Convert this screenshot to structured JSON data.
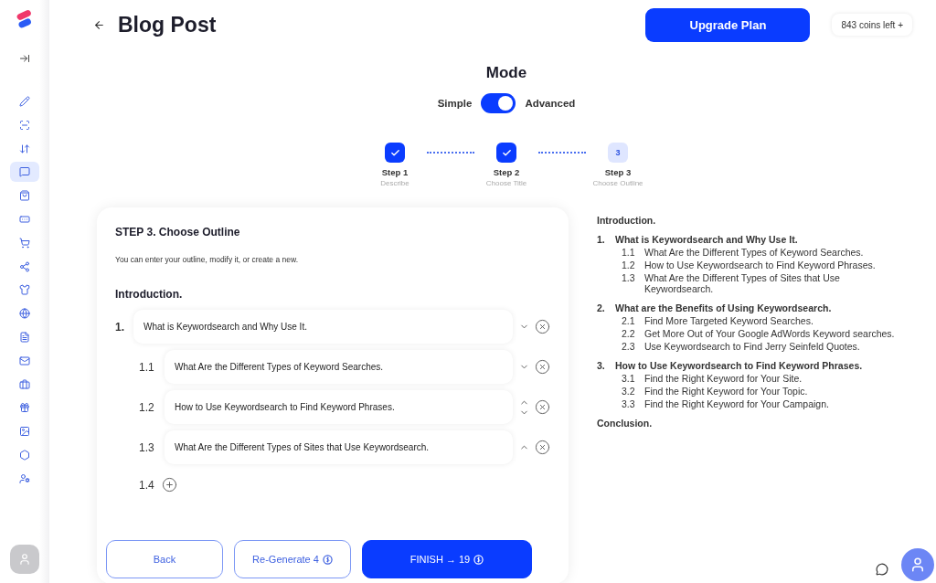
{
  "sidebar": {
    "items": [
      {
        "selected": false
      },
      {
        "selected": false
      },
      {
        "selected": false
      },
      {
        "selected": true
      },
      {
        "selected": false
      },
      {
        "selected": false
      },
      {
        "selected": false
      },
      {
        "selected": false
      },
      {
        "selected": false
      },
      {
        "selected": false
      },
      {
        "selected": false
      },
      {
        "selected": false
      },
      {
        "selected": false
      },
      {
        "selected": false
      },
      {
        "selected": false
      },
      {
        "selected": false
      },
      {
        "selected": false
      }
    ]
  },
  "header": {
    "title": "Blog Post",
    "upgrade_button": "Upgrade Plan",
    "coins": "843 coins left",
    "coins_add": "+"
  },
  "mode": {
    "title": "Mode",
    "left_label": "Simple",
    "right_label": "Advanced",
    "on": true
  },
  "steps": [
    {
      "label": "Step 1",
      "caption": "Describe",
      "done": true
    },
    {
      "label": "Step 2",
      "caption": "Choose Title",
      "done": true
    },
    {
      "label": "Step 3",
      "caption": "Choose Outline",
      "done": false,
      "number": "3"
    }
  ],
  "editor": {
    "title": "STEP 3. Choose Outline",
    "description": "You can enter your outline, modify it, or create a new.",
    "intro": "Introduction.",
    "items": [
      {
        "number": "1.",
        "text": "What is Keywordsearch and Why Use It.",
        "up": false,
        "down": true,
        "children": [
          {
            "number": "1.1",
            "text": "What Are the Different Types of Keyword Searches.",
            "up": false,
            "down": true
          },
          {
            "number": "1.2",
            "text": "How to Use Keywordsearch to Find Keyword Phrases.",
            "up": true,
            "down": true
          },
          {
            "number": "1.3",
            "text": "What Are the Different Types of Sites that Use Keywordsearch.",
            "up": true,
            "down": false
          }
        ],
        "add_number": "1.4"
      }
    ]
  },
  "footer": {
    "back": "Back",
    "regenerate": "Re-Generate 4",
    "finish": "FINISH → 19"
  },
  "preview": {
    "intro": "Introduction.",
    "sections": [
      {
        "number": "1.",
        "title": "What is Keywordsearch and Why Use It.",
        "children": [
          {
            "number": "1.1",
            "text": "What Are the Different Types of Keyword Searches."
          },
          {
            "number": "1.2",
            "text": "How to Use Keywordsearch to Find Keyword Phrases."
          },
          {
            "number": "1.3",
            "text": "What Are the Different Types of Sites that Use Keywordsearch."
          }
        ]
      },
      {
        "number": "2.",
        "title": "What are the Benefits of Using Keywordsearch.",
        "children": [
          {
            "number": "2.1",
            "text": "Find More Targeted Keyword Searches."
          },
          {
            "number": "2.2",
            "text": "Get More Out of Your Google AdWords Keyword searches."
          },
          {
            "number": "2.3",
            "text": "Use Keywordsearch to Find Jerry Seinfeld Quotes."
          }
        ]
      },
      {
        "number": "3.",
        "title": "How to Use Keywordsearch to Find Keyword Phrases.",
        "children": [
          {
            "number": "3.1",
            "text": "Find the Right Keyword for Your Site."
          },
          {
            "number": "3.2",
            "text": "Find the Right Keyword for Your Topic."
          },
          {
            "number": "3.3",
            "text": "Find the Right Keyword for Your Campaign."
          }
        ]
      }
    ],
    "conclusion": "Conclusion."
  }
}
